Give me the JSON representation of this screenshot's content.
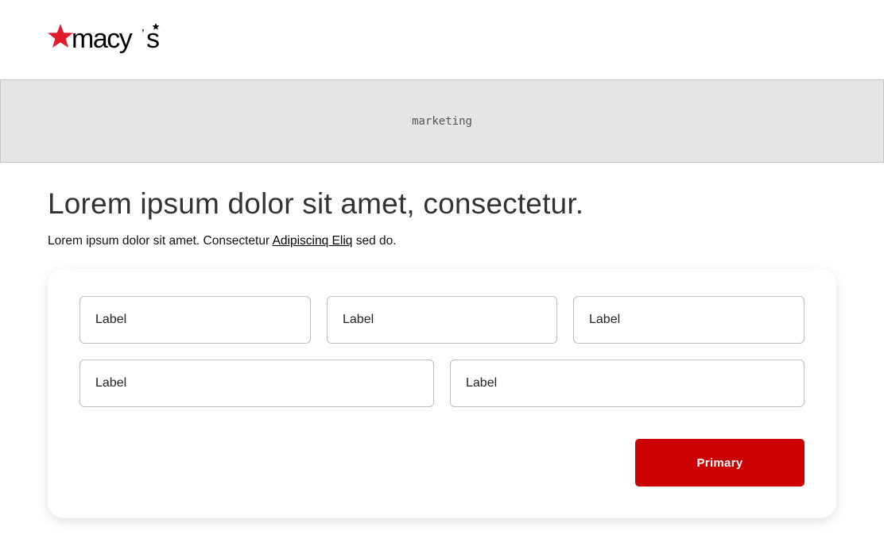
{
  "brand": {
    "name": "macy's",
    "accent_color": "#cc0000"
  },
  "marketing": {
    "placeholder": "marketing"
  },
  "main": {
    "title": "Lorem ipsum dolor sit amet, consectetur.",
    "subtitle_before": "Lorem ipsum dolor sit amet. Consectetur ",
    "subtitle_link": "Adipiscinq Eliq",
    "subtitle_after": " sed do."
  },
  "form": {
    "fields": [
      {
        "label": "Label"
      },
      {
        "label": "Label"
      },
      {
        "label": "Label"
      },
      {
        "label": "Label"
      },
      {
        "label": "Label"
      }
    ],
    "primary_label": "Primary"
  }
}
